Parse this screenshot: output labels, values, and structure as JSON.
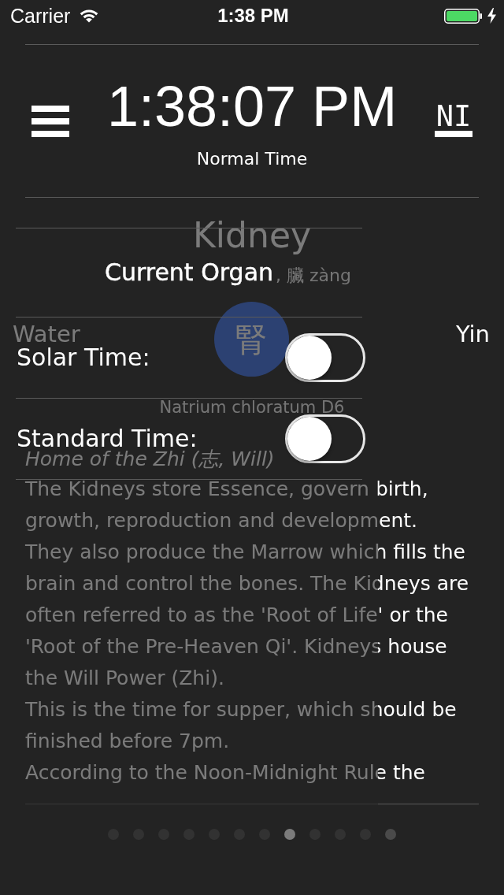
{
  "status_bar": {
    "carrier": "Carrier",
    "time": "1:38 PM",
    "charging": true
  },
  "header": {
    "clock": "1:38:07 PM",
    "mode_button": "NI",
    "mode": "Normal Time"
  },
  "menu": {
    "title": "Current Organ",
    "toggles": [
      {
        "label": "Solar Time:",
        "on": false
      },
      {
        "label": "Standard Time:",
        "on": false
      }
    ]
  },
  "organ": {
    "name": "Kidney",
    "subtitle": ", 臟 zàng",
    "element": "Water",
    "symbol": "腎",
    "polarity": "Yin",
    "remedy": "Natrium chloratum D6",
    "home": "Home of the Zhi (志, Will)",
    "description": [
      "The Kidneys store Essence, govern birth, growth, reproduction and development.",
      "They also produce the Marrow which fills the brain and control the bones. The Kidneys are often referred to as the 'Root of Life' or the 'Root of the Pre-Heaven Qi'. Kidneys house the Will Power (Zhi).",
      "This is the time for supper, which should be finished before 7pm."
    ],
    "note": "According to the Noon-Midnight Rule the"
  },
  "pager": {
    "pages": [
      {
        "selected": false
      },
      {
        "selected": false
      },
      {
        "selected": false
      },
      {
        "selected": false
      },
      {
        "selected": false
      },
      {
        "selected": false
      },
      {
        "selected": false
      },
      {
        "selected": true
      },
      {
        "selected": false
      },
      {
        "selected": false
      },
      {
        "selected": false
      },
      {
        "selected": false
      }
    ]
  }
}
